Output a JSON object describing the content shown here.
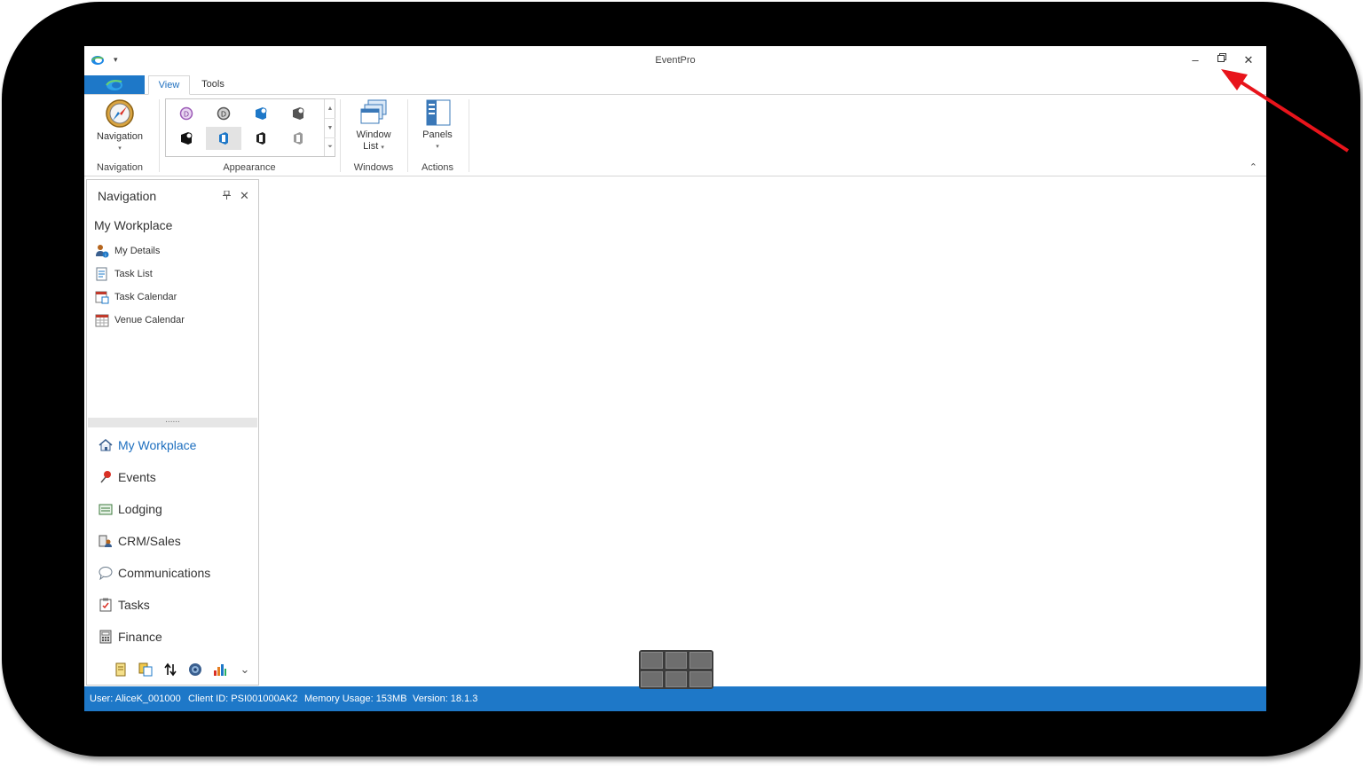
{
  "app": {
    "title": "EventPro"
  },
  "window_controls": {
    "minimize": "–",
    "restore": "🗗",
    "close": "✕"
  },
  "tabs": [
    {
      "label": "View",
      "active": true
    },
    {
      "label": "Tools",
      "active": false
    }
  ],
  "ribbon": {
    "navigation_button": "Navigation",
    "window_list_line1": "Window",
    "window_list_line2": "List",
    "panels_button": "Panels",
    "groups": {
      "navigation": "Navigation",
      "appearance": "Appearance",
      "windows": "Windows",
      "actions": "Actions"
    }
  },
  "nav_panel": {
    "title": "Navigation",
    "pin": "⊓",
    "close": "✕",
    "section_title": "My Workplace",
    "items": [
      {
        "label": "My Details",
        "icon": "user-info-icon"
      },
      {
        "label": "Task List",
        "icon": "task-list-icon"
      },
      {
        "label": "Task Calendar",
        "icon": "task-calendar-icon"
      },
      {
        "label": "Venue Calendar",
        "icon": "venue-calendar-icon"
      }
    ],
    "splitter_grip": "......",
    "modules": [
      {
        "label": "My Workplace",
        "icon": "home-icon",
        "active": true
      },
      {
        "label": "Events",
        "icon": "pin-icon"
      },
      {
        "label": "Lodging",
        "icon": "lodging-icon"
      },
      {
        "label": "CRM/Sales",
        "icon": "crm-icon"
      },
      {
        "label": "Communications",
        "icon": "speech-bubble-icon"
      },
      {
        "label": "Tasks",
        "icon": "clipboard-icon"
      },
      {
        "label": "Finance",
        "icon": "calculator-icon"
      }
    ],
    "more": "⌄"
  },
  "status_bar": {
    "user": "User: AliceK_001000",
    "client_id": "Client ID: PSI001000AK2",
    "memory": "Memory Usage: 153MB",
    "version": "Version: 18.1.3"
  },
  "colors": {
    "accent": "#1e78c8",
    "annotation_arrow": "#e8141b"
  }
}
